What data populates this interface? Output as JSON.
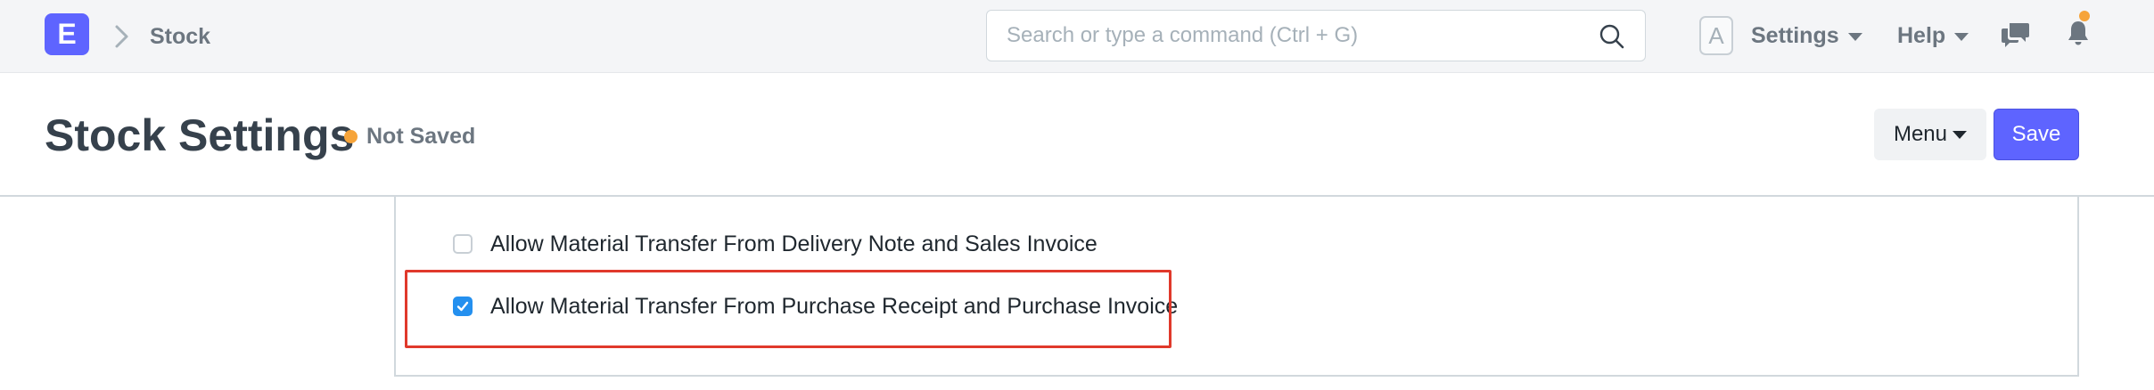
{
  "navbar": {
    "logo_letter": "E",
    "breadcrumb": "Stock",
    "search": {
      "placeholder": "Search or type a command (Ctrl + G)",
      "value": ""
    },
    "avatar_letter": "A",
    "settings_label": "Settings",
    "help_label": "Help",
    "icons": {
      "breadcrumb": "chevron-right-icon",
      "search": "search-icon",
      "chat": "chat-icon",
      "notifications": "bell-icon"
    }
  },
  "page": {
    "title": "Stock Settings",
    "status": "Not Saved",
    "status_color": "#f6a43a",
    "menu_label": "Menu",
    "save_label": "Save"
  },
  "form": {
    "fields": [
      {
        "label": "Allow Material Transfer From Delivery Note and Sales Invoice",
        "checked": false
      },
      {
        "label": "Allow Material Transfer From Purchase Receipt and Purchase Invoice",
        "checked": true
      }
    ]
  },
  "colors": {
    "primary": "#5e64ff",
    "checkbox_checked": "#2490ef",
    "highlight": "#e0392b"
  }
}
